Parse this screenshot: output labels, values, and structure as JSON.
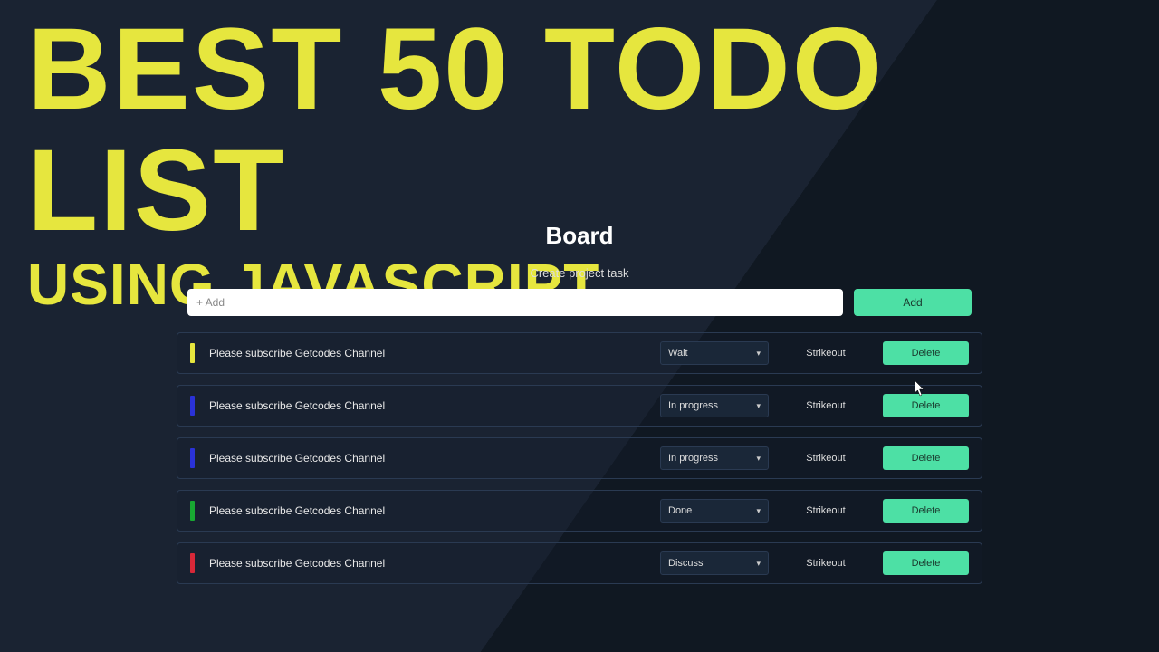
{
  "headline": {
    "main": "BEST 50 TODO LIST",
    "sub": "USING JAVASCRIPT"
  },
  "board": {
    "title": "Board",
    "create_label": "Create project task",
    "input_placeholder": "+ Add",
    "add_button": "Add",
    "strikeout_label": "Strikeout",
    "delete_label": "Delete"
  },
  "tasks": [
    {
      "text": "Please subscribe Getcodes Channel",
      "status": "Wait",
      "color": "#e6e63e"
    },
    {
      "text": "Please subscribe Getcodes Channel",
      "status": "In progress",
      "color": "#2a32d8"
    },
    {
      "text": "Please subscribe Getcodes Channel",
      "status": "In progress",
      "color": "#2a32d8"
    },
    {
      "text": "Please subscribe Getcodes Channel",
      "status": "Done",
      "color": "#18a832"
    },
    {
      "text": "Please subscribe Getcodes Channel",
      "status": "Discuss",
      "color": "#d82838"
    }
  ]
}
